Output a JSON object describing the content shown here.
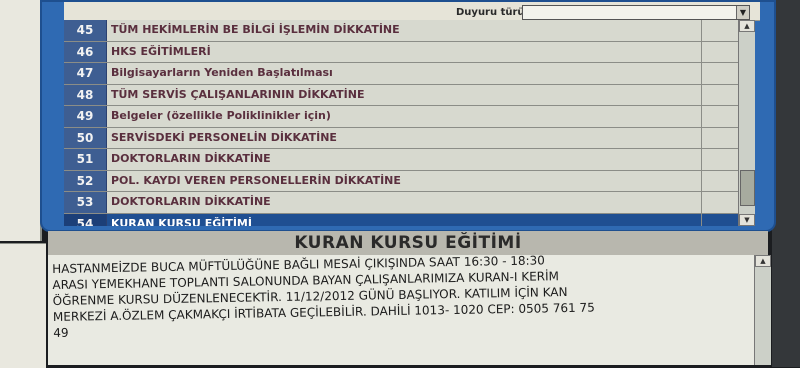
{
  "header": {
    "type_label": "Duyuru türü",
    "type_value": ""
  },
  "announcements": [
    {
      "num": "45",
      "title": "TÜM HEKİMLERİN BE BİLGİ İŞLEMİN DİKKATİNE"
    },
    {
      "num": "46",
      "title": "HKS EĞİTİMLERİ"
    },
    {
      "num": "47",
      "title": "Bilgisayarların Yeniden Başlatılması"
    },
    {
      "num": "48",
      "title": "TÜM SERVİS ÇALIŞANLARININ DİKKATİNE"
    },
    {
      "num": "49",
      "title": "Belgeler (özellikle Poliklinikler için)"
    },
    {
      "num": "50",
      "title": "SERVİSDEKİ PERSONELİN DİKKATİNE"
    },
    {
      "num": "51",
      "title": "DOKTORLARIN DİKKATİNE"
    },
    {
      "num": "52",
      "title": "POL. KAYDI VEREN PERSONELLERİN DİKKATİNE"
    },
    {
      "num": "53",
      "title": "DOKTORLARIN DİKKATİNE"
    },
    {
      "num": "54",
      "title": "KURAN KURSU EĞİTİMİ",
      "selected": true
    }
  ],
  "detail": {
    "title": "KURAN KURSU EĞİTİMİ",
    "line1": "HASTANMEİZDE BUCA MÜFTÜLÜĞÜNE BAĞLI MESAİ ÇIKIŞINDA SAAT 16:30 - 18:30",
    "line2": "ARASI YEMEKHANE TOPLANTI SALONUNDA BAYAN ÇALIŞANLARIMIZA KURAN-I KERİM",
    "line3": "ÖĞRENME KURSU DÜZENLENECEKTİR. 11/12/2012 GÜNÜ BAŞLIYOR. KATILIM İÇİN KAN",
    "line4": "MERKEZİ A.ÖZLEM ÇAKMAKÇI İRTİBATA GEÇİLEBİLİR. DAHİLİ 1013- 1020 CEP: 0505 761 75",
    "line5": "49"
  },
  "colors": {
    "frame": "#2f6ab3",
    "selected_row": "#1f4f92",
    "row_bg": "#d7d9cf",
    "title_text": "#5a2f3e"
  }
}
